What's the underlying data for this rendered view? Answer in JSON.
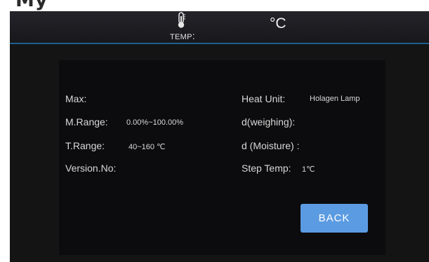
{
  "window_title_fragment": "My",
  "header": {
    "temp_label": "TEMP",
    "temp_colon": ":",
    "unit": "°C",
    "accent_color": "#1f5f8f"
  },
  "info": {
    "max": {
      "label": "Max:",
      "value": ""
    },
    "m_range": {
      "label": "M.Range:",
      "value": "0.00%~100.00%"
    },
    "t_range": {
      "label": "T.Range:",
      "value": "40~160 ℃"
    },
    "version": {
      "label": "Version.No:",
      "value": ""
    },
    "heat_unit": {
      "label": "Heat Unit:",
      "value": "Holagen Lamp"
    },
    "d_weighing": {
      "label": "d(weighing):",
      "value": ""
    },
    "d_moisture": {
      "label": "d (Moisture) :",
      "value": ""
    },
    "step_temp": {
      "label": "Step Temp:",
      "value": "1℃"
    }
  },
  "back_button": {
    "label": "BACK",
    "color": "#5b9be2"
  }
}
